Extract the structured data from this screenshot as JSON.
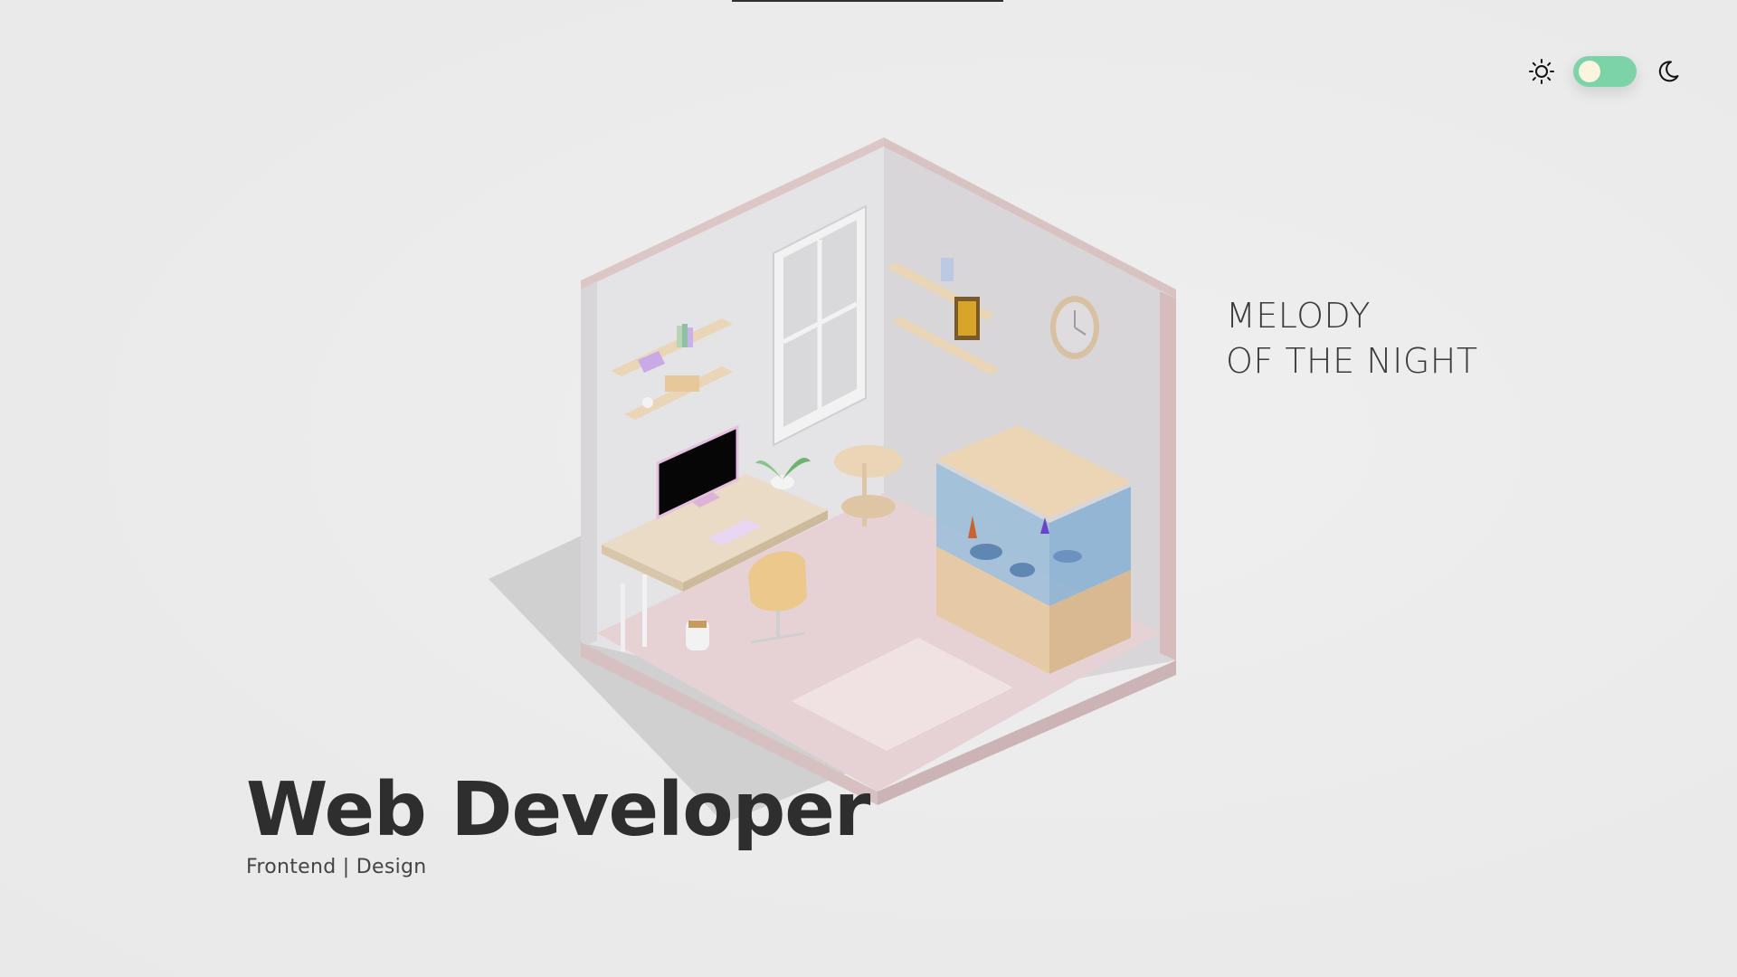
{
  "header": {
    "theme_toggle": {
      "light_icon": "sun-icon",
      "dark_icon": "moon-icon",
      "state": "light",
      "track_color": "#7dd3a8",
      "knob_color": "#fbf5df"
    }
  },
  "hero": {
    "title": "Web Developer",
    "subtitle": "Frontend | Design"
  },
  "side_text": {
    "line1": "MELODY",
    "line2": "OF THE NIGHT"
  },
  "colors": {
    "background": "#ebebeb",
    "room_wall": "#e0dfe1",
    "room_trim": "#dcc4c4",
    "floor": "#e2cccf",
    "wood": "#ead5b6",
    "aquarium_water": "#8fb5d6"
  }
}
